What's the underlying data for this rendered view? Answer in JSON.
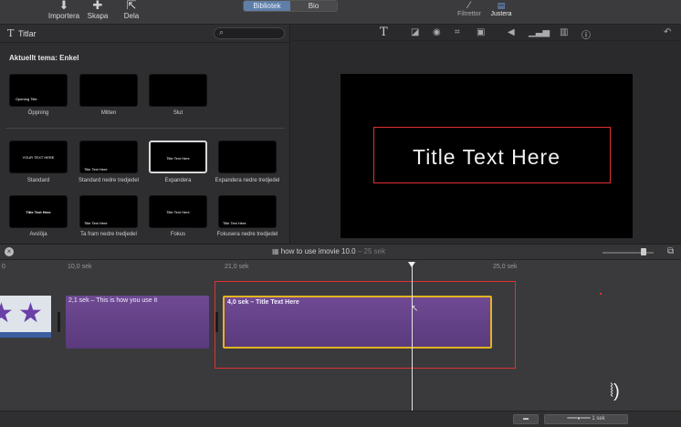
{
  "toolbar": {
    "import_label": "Importera",
    "create_label": "Skapa",
    "share_label": "Dela",
    "tab_library": "Bibliotek",
    "tab_theater": "Bio",
    "filters_label": "Filtrettor",
    "adjust_label": "Justera"
  },
  "browser": {
    "title": "Titlar",
    "search_placeholder": "",
    "theme_heading": "Aktuellt tema: Enkel",
    "theme_titles": [
      {
        "label": "Öppning",
        "mini": "Opening Title"
      },
      {
        "label": "Mitten",
        "mini": ""
      },
      {
        "label": "Slut",
        "mini": ""
      }
    ],
    "titles": [
      {
        "label": "Standard",
        "mini": "YOUR TEXT HERE"
      },
      {
        "label": "Standard nedre tredjedel",
        "mini": "Title Text Here"
      },
      {
        "label": "Expandera",
        "mini": "Title Text Here"
      },
      {
        "label": "Expandera nedre tredjedel",
        "mini": ""
      },
      {
        "label": "Avslöja",
        "mini": "Title Text Here"
      },
      {
        "label": "Ta fram nedre tredjedel",
        "mini": "Title Text Here"
      },
      {
        "label": "Fokus",
        "mini": "Title Text Here"
      },
      {
        "label": "Fokusera nedre tredjedel",
        "mini": "Title Text Here"
      }
    ]
  },
  "viewer": {
    "preview_text": "Title Text Here"
  },
  "timeline": {
    "project_name": "how to use imovie 10.0",
    "project_duration": "– 25 sek",
    "ruler_ticks": [
      "0",
      "10,0 sek",
      "21,0 sek",
      "25,0 sek"
    ],
    "clips": [
      {
        "label": "2,1 sek – This is how you use it"
      },
      {
        "label": "4,0 sek – Title Text Here"
      }
    ],
    "zoom_label": "1 sek"
  },
  "colors": {
    "accent": "#5f7fa8",
    "title_clip": "#6a4590",
    "selection": "#e2b422",
    "highlight": "#e23030"
  }
}
